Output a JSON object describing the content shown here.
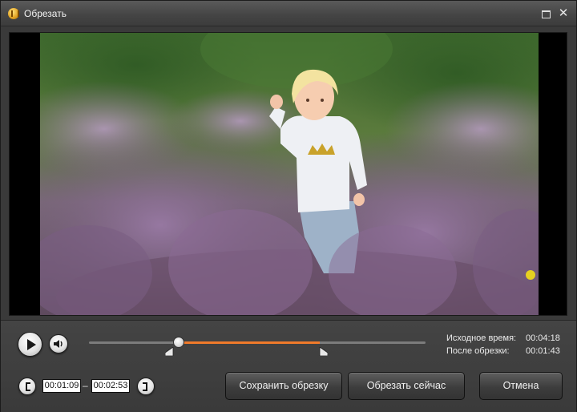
{
  "window": {
    "title": "Обрезать",
    "maximize_icon": "maximize-icon",
    "close_icon": "close-icon",
    "close_glyph": "✕"
  },
  "player": {
    "play_icon": "play-icon",
    "volume_icon": "speaker-icon",
    "playhead_fraction": 0.267,
    "trim_start_fraction": 0.245,
    "trim_end_fraction": 0.685,
    "fill_color": "#f07a2a"
  },
  "info": {
    "original_label": "Исходное время:",
    "original_value": "00:04:18",
    "trimmed_label": "После обрезки:",
    "trimmed_value": "00:01:43"
  },
  "trim": {
    "start_value": "00:01:09",
    "separator": "–",
    "end_value": "00:02:53",
    "start_icon": "bracket-left-icon",
    "end_icon": "bracket-right-icon"
  },
  "buttons": {
    "save": "Сохранить обрезку",
    "cut": "Обрезать сейчас",
    "cancel": "Отмена"
  }
}
